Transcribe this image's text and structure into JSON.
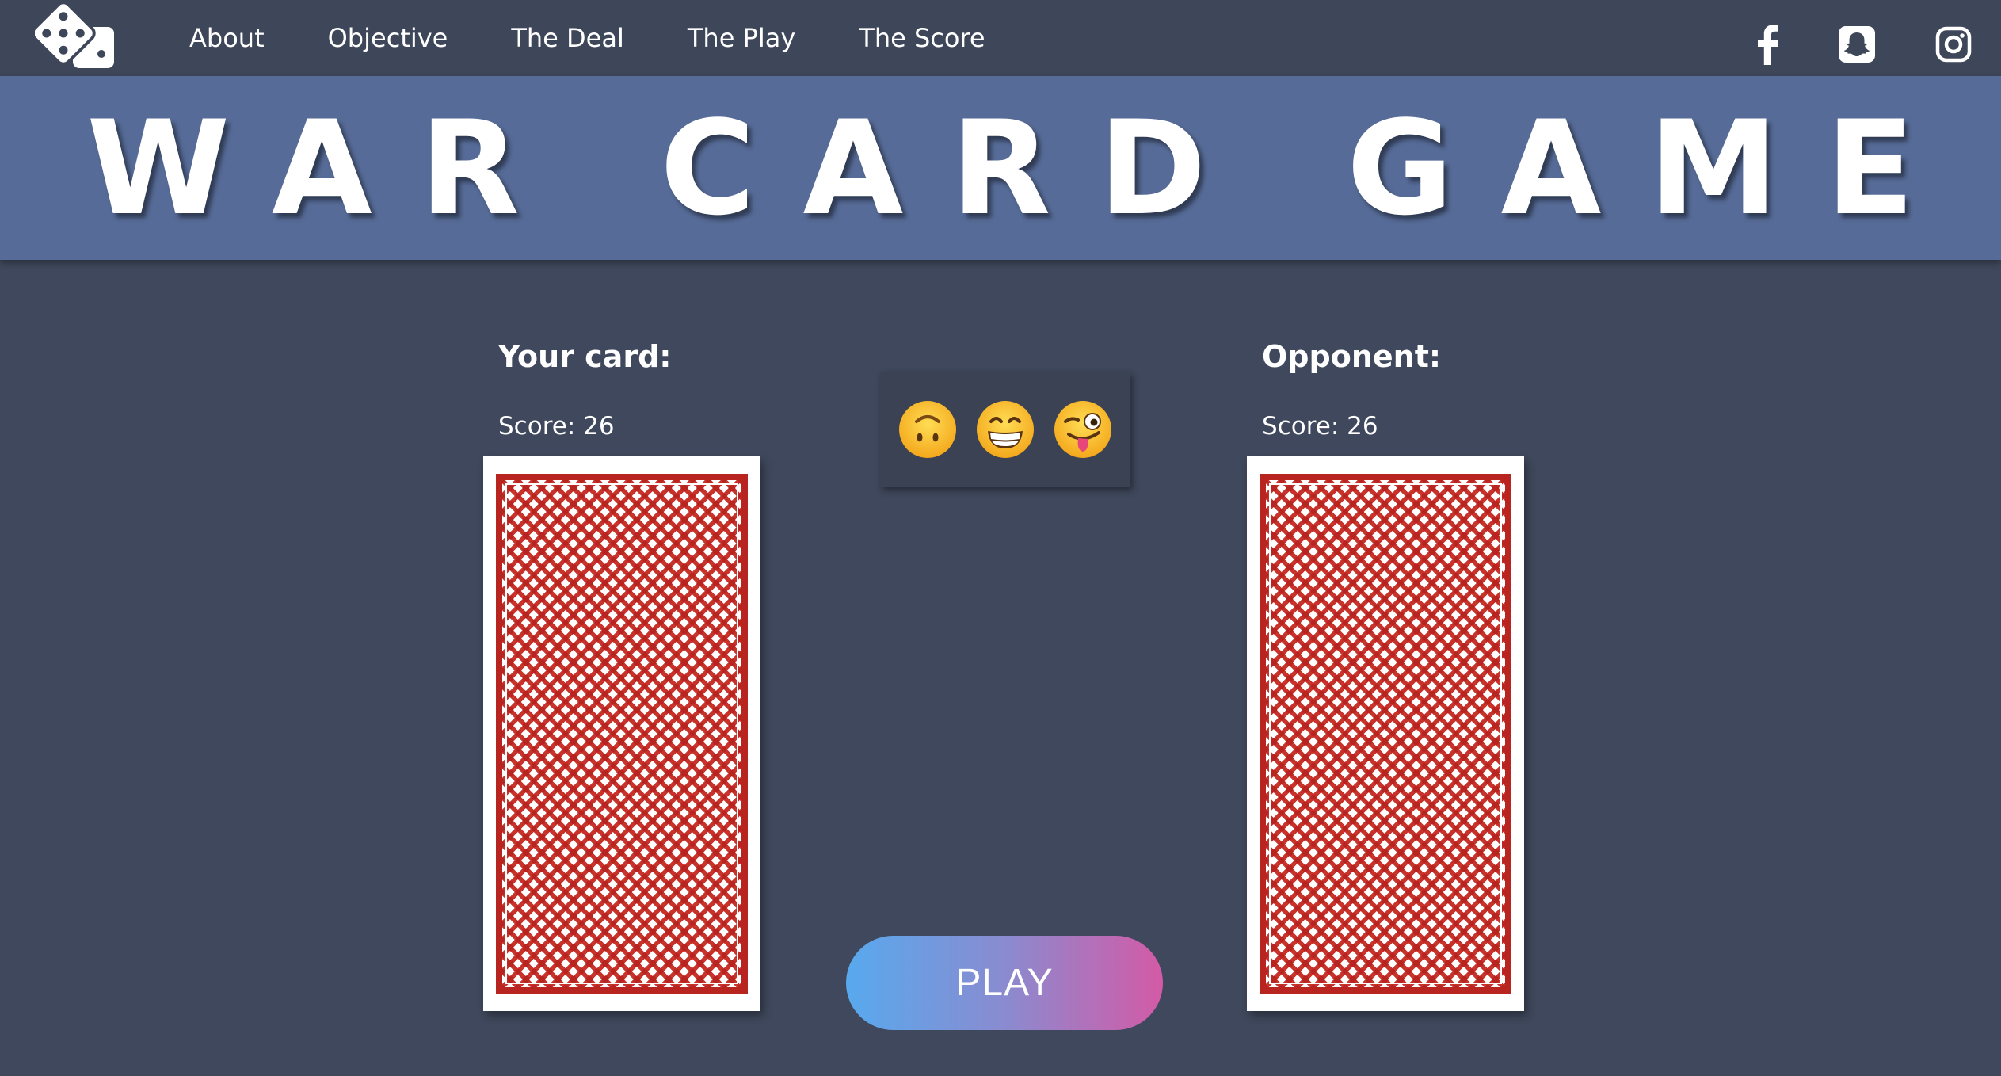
{
  "nav": {
    "links": [
      "About",
      "Objective",
      "The Deal",
      "The Play",
      "The Score"
    ],
    "logo_icon": "dice-icon",
    "social_icons": [
      "facebook-icon",
      "snapchat-icon",
      "instagram-icon"
    ]
  },
  "banner": {
    "title": "WAR CARD GAME"
  },
  "player": {
    "heading": "Your card:",
    "score_label": "Score: 26"
  },
  "opponent": {
    "heading": "Opponent:",
    "score_label": "Score: 26"
  },
  "emoji_panel": {
    "emojis": [
      "upside-down-face-icon",
      "grinning-face-icon",
      "winking-tongue-face-icon"
    ]
  },
  "play_button": {
    "label": "PLAY"
  },
  "colors": {
    "background": "#3f485c",
    "navbar": "#3e4659",
    "banner": "#566b97",
    "card_back_red": "#b8241f",
    "play_gradient_start": "#58a9ee",
    "play_gradient_end": "#d45aa6"
  }
}
